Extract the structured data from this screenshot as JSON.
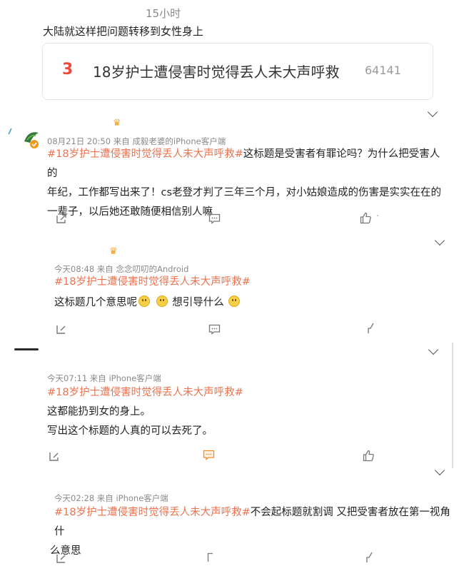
{
  "top": {
    "time": "15小时",
    "lead_text": "大陆就这样把问题转移到女性身上"
  },
  "trend_card": {
    "rank": "3",
    "title": "18岁护士遭侵害时觉得丢人未大声呼救",
    "count": "64141"
  },
  "comments": [
    {
      "meta": "08月21日 20:50  来自 成毅老婆的iPhone客户端",
      "hashtag": "#18岁护士遭侵害时觉得丢人未大声呼救#",
      "line1_rest": "这标题是受害者有罪论吗？为什么把受害人的",
      "line2": "年纪，工作都写出来了！cs老登才判了三年三个月，对小姑娘造成的伤害是实实在在的",
      "line3": "一辈子，以后她还敢随便相信别人嘛"
    },
    {
      "meta": "今天08:48  来自 念念叨叨的Android",
      "hashtag": "#18岁护士遭侵害时觉得丢人未大声呼救#",
      "text_a": "这标题几个意思呢",
      "text_b": "想引导什么"
    },
    {
      "meta": "今天07:11  来自 iPhone客户端",
      "hashtag": "#18岁护士遭侵害时觉得丢人未大声呼救#",
      "line1": "这都能扔到女的身上。",
      "line2": "写出这个标题的人真的可以去死了。"
    },
    {
      "meta": "今天02:28  来自 iPhone客户端",
      "hashtag": "#18岁护士遭侵害时觉得丢人未大声呼救#",
      "line1_rest": "不会起标题就割调 又把受害者放在第一视角什",
      "line2": "么意思"
    }
  ],
  "icons": {
    "repost": "repost-icon",
    "comment": "comment-icon",
    "like": "like-icon",
    "expand": "chevron-down-icon",
    "crown": "crown-icon"
  },
  "colors": {
    "hashtag": "#eb7350",
    "rank": "#f04a3a",
    "meta": "#8a8a8a",
    "crown": "#f0a020",
    "comment_active": "#f08a24"
  }
}
